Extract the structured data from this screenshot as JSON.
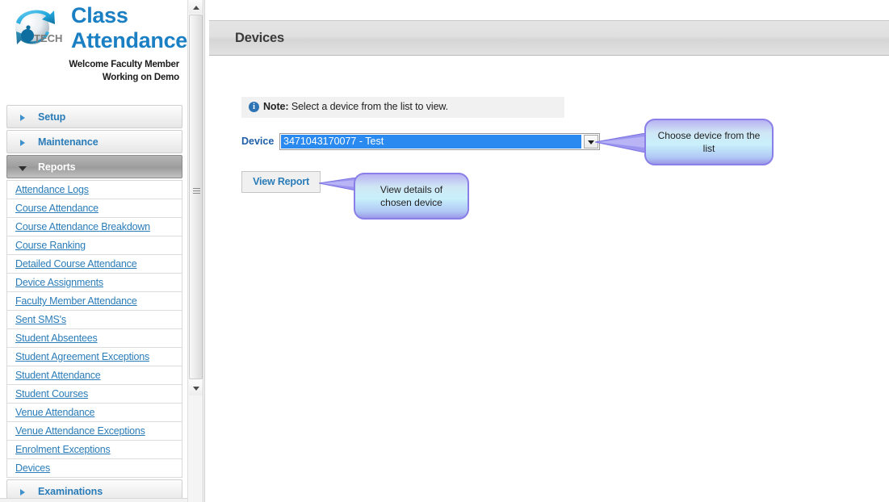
{
  "brand": {
    "logo_icon": "iptech-globe-logo",
    "title_line1": "Class",
    "title_line2": "Attendance",
    "welcome": "Welcome Faculty Member",
    "working_on": "Working on Demo"
  },
  "sidebar": {
    "sections": [
      {
        "label": "Setup",
        "expanded": false,
        "icon": "chevron-right-icon"
      },
      {
        "label": "Maintenance",
        "expanded": false,
        "icon": "chevron-right-icon"
      },
      {
        "label": "Reports",
        "expanded": true,
        "icon": "chevron-down-icon"
      }
    ],
    "reports": [
      "Attendance Logs",
      "Course Attendance",
      "Course Attendance Breakdown",
      "Course Ranking",
      "Detailed Course Attendance",
      "Device Assignments",
      "Faculty Member Attendance",
      "Sent SMS's",
      "Student Absentees",
      "Student Agreement Exceptions",
      "Student Attendance",
      "Student Courses",
      "Venue Attendance",
      "Venue Attendance Exceptions",
      "Enrolment Exceptions",
      "Devices"
    ],
    "bottom_sections": [
      {
        "label": "Examinations",
        "expanded": false,
        "icon": "chevron-right-icon"
      }
    ]
  },
  "scrollbar": {
    "up_icon": "scroll-up-arrow-icon",
    "down_icon": "scroll-down-arrow-icon",
    "grip_icon": "scrollbar-grip-icon"
  },
  "main": {
    "page_title": "Devices",
    "note": {
      "icon": "info-icon",
      "icon_glyph": "i",
      "prefix": "Note:",
      "text": " Select a device from the list to view."
    },
    "device": {
      "label": "Device",
      "selected_value": "3471043170077 - Test",
      "dropdown_icon": "chevron-down-icon"
    },
    "view_report_label": "View Report"
  },
  "callouts": [
    {
      "id": "device",
      "text": "Choose device from the list"
    },
    {
      "id": "report",
      "text": "View details of chosen device"
    }
  ],
  "colors": {
    "link_blue": "#2a7cb8",
    "brand_blue": "#1b7fc4",
    "selection_blue": "#2a8aef",
    "callout_border": "#8a7fe8",
    "info_icon": "#2e74b5"
  }
}
